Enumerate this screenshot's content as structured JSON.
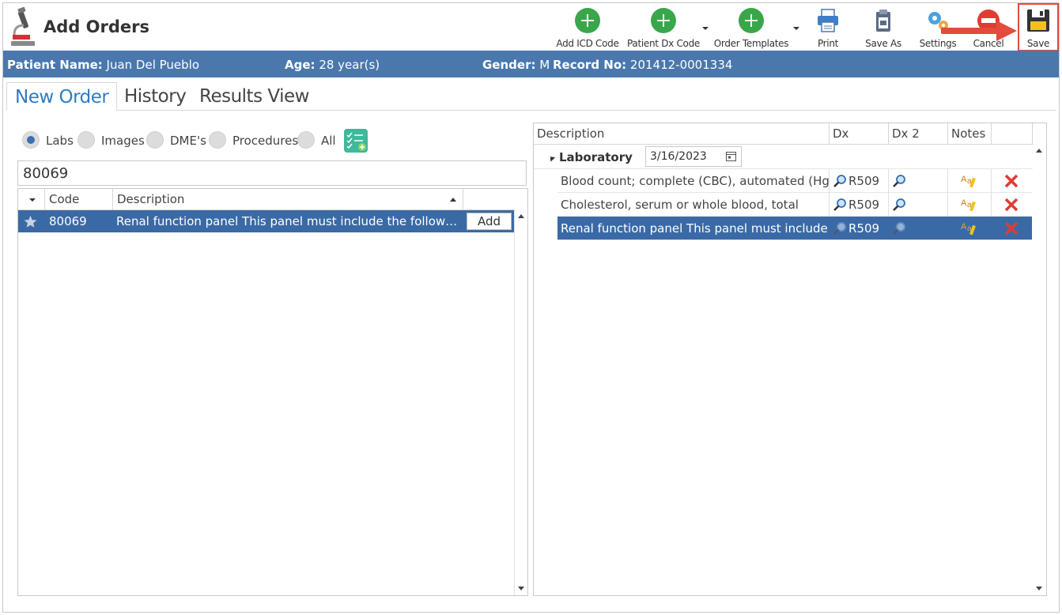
{
  "window": {
    "title": "Add Orders"
  },
  "toolbar": {
    "add_icd": "Add ICD Code",
    "patient_dx": "Patient Dx Code",
    "order_templates": "Order Templates",
    "print": "Print",
    "save_as": "Save As",
    "settings": "Settings",
    "cancel": "Cancel",
    "save": "Save"
  },
  "patient": {
    "name_label": "Patient Name:",
    "name": "Juan Del Pueblo",
    "age_label": "Age:",
    "age": "28 year(s)",
    "gender_label": "Gender:",
    "gender": "M",
    "record_label": "Record No:",
    "record": "201412-0001334"
  },
  "tabs": [
    "New Order",
    "History",
    "Results View"
  ],
  "filters": {
    "options": [
      "Labs",
      "Images",
      "DME's",
      "Procedures",
      "All"
    ],
    "selected": "Labs"
  },
  "search": {
    "value": "80069"
  },
  "left_grid": {
    "columns": [
      "Code",
      "Description"
    ],
    "rows": [
      {
        "code": "80069",
        "description": "Renal function panel This panel must include the following: Alb...",
        "action": "Add"
      }
    ]
  },
  "right_grid": {
    "columns": [
      "Description",
      "Dx",
      "Dx 2",
      "Notes"
    ],
    "group": {
      "name": "Laboratory",
      "date": "3/16/2023"
    },
    "rows": [
      {
        "description": "Blood count; complete (CBC), automated (Hgb,...",
        "dx": "R509"
      },
      {
        "description": "Cholesterol, serum or whole blood, total",
        "dx": "R509"
      },
      {
        "description": "Renal function panel This panel must include the...",
        "dx": "R509"
      }
    ]
  },
  "colors": {
    "accent_blue": "#4a78ad",
    "selection": "#3a6aa5",
    "add_green": "#3aa64a",
    "highlight_red": "#e34b3d"
  }
}
